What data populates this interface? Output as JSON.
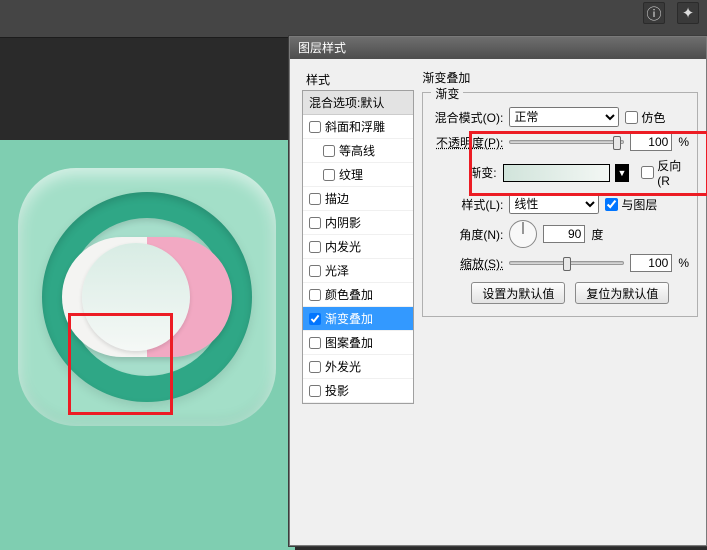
{
  "dialog_title": "图层样式",
  "section_title": "渐变叠加",
  "styles_panel_header": "样式",
  "styles_selected_header": "混合选项:默认",
  "style_items": [
    {
      "label": "斜面和浮雕",
      "checked": false
    },
    {
      "label": "等高线",
      "checked": false,
      "sub": true
    },
    {
      "label": "纹理",
      "checked": false,
      "sub": true
    },
    {
      "label": "描边",
      "checked": false
    },
    {
      "label": "内阴影",
      "checked": false
    },
    {
      "label": "内发光",
      "checked": false
    },
    {
      "label": "光泽",
      "checked": false
    },
    {
      "label": "颜色叠加",
      "checked": false
    },
    {
      "label": "渐变叠加",
      "checked": true,
      "selected": true
    },
    {
      "label": "图案叠加",
      "checked": false
    },
    {
      "label": "外发光",
      "checked": false
    },
    {
      "label": "投影",
      "checked": false
    }
  ],
  "inner_fieldset_legend": "渐变",
  "labels": {
    "blend_mode": "混合模式(O):",
    "opacity": "不透明度(P):",
    "gradient": "渐变:",
    "style": "样式(L):",
    "angle": "角度(N):",
    "scale": "缩放(S):"
  },
  "values": {
    "blend_mode": "正常",
    "opacity": "100",
    "style": "线性",
    "angle": "90",
    "scale": "100"
  },
  "checks": {
    "dither": "仿色",
    "reverse": "反向(R",
    "align": "与图层"
  },
  "units": {
    "pct": "%",
    "deg": "度"
  },
  "buttons": {
    "set_default": "设置为默认值",
    "reset_default": "复位为默认值"
  }
}
